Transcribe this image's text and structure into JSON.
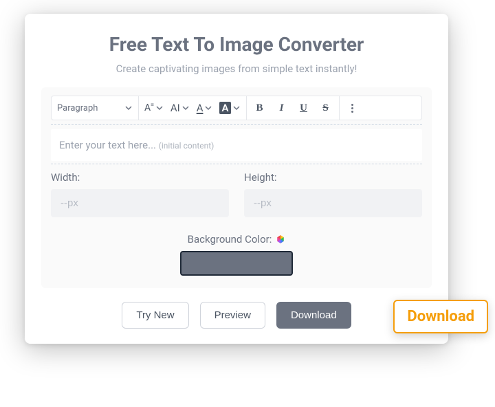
{
  "title": "Free Text To Image Converter",
  "subtitle": "Create captivating images from simple text instantly!",
  "toolbar": {
    "paragraph": "Paragraph",
    "fontsize_glyph": "A",
    "case_glyph": "AI",
    "fontcolor_glyph": "A",
    "bgcolor_glyph": "A",
    "bold_glyph": "B",
    "italic_glyph": "I",
    "underline_glyph": "U",
    "strike_glyph": "S"
  },
  "editor": {
    "placeholder": "Enter your text here...",
    "hint": "(initial content)"
  },
  "dims": {
    "width_label": "Width:",
    "height_label": "Height:",
    "placeholder": "--px"
  },
  "bg": {
    "label": "Background Color:",
    "value": "#6b7280"
  },
  "buttons": {
    "try_new": "Try New",
    "preview": "Preview",
    "download": "Download"
  },
  "callout": "Download"
}
